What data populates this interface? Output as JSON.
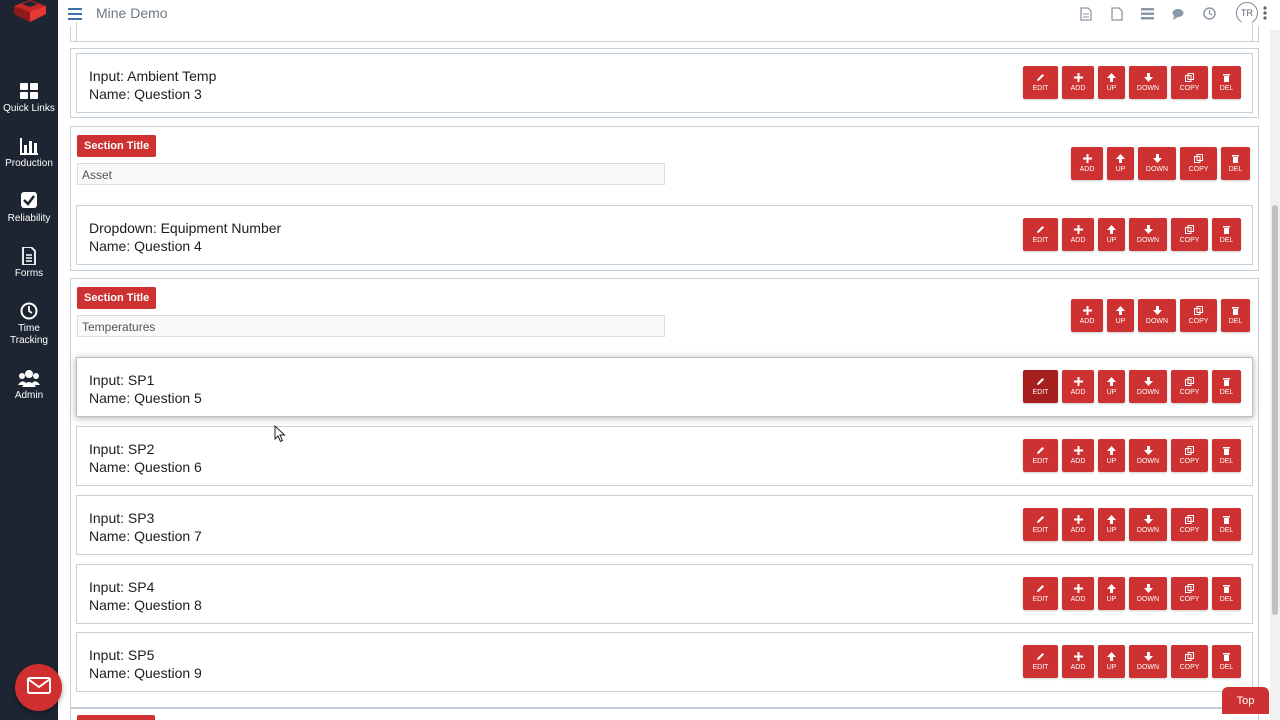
{
  "app": {
    "title": "Mine Demo",
    "user_initials": "TR"
  },
  "sidebar": {
    "items": [
      {
        "label": "Quick Links",
        "icon": "grid-icon"
      },
      {
        "label": "Production",
        "icon": "bar-chart-icon"
      },
      {
        "label": "Reliability",
        "icon": "checkbox-icon"
      },
      {
        "label": "Forms",
        "icon": "document-icon"
      },
      {
        "label": "Time Tracking",
        "icon": "clock-icon"
      },
      {
        "label": "Admin",
        "icon": "users-icon"
      }
    ]
  },
  "buttons": {
    "edit": "EDIT",
    "add": "ADD",
    "up": "UP",
    "down": "DOWN",
    "copy": "COPY",
    "del": "DEL"
  },
  "sections": [
    {
      "title": "Section Title",
      "value": "Asset"
    },
    {
      "title": "Section Title",
      "value": "Temperatures"
    }
  ],
  "questions": [
    {
      "type": "Input: Ambient Temp",
      "name": "Name: Question 3"
    },
    {
      "type": "Dropdown: Equipment Number",
      "name": "Name: Question 4"
    },
    {
      "type": "Input: SP1",
      "name": "Name: Question 5"
    },
    {
      "type": "Input: SP2",
      "name": "Name: Question 6"
    },
    {
      "type": "Input: SP3",
      "name": "Name: Question 7"
    },
    {
      "type": "Input: SP4",
      "name": "Name: Question 8"
    },
    {
      "type": "Input: SP5",
      "name": "Name: Question 9"
    }
  ],
  "top_button": "Top",
  "colors": {
    "accent": "#cd3131",
    "sidebar": "#1c2531"
  }
}
